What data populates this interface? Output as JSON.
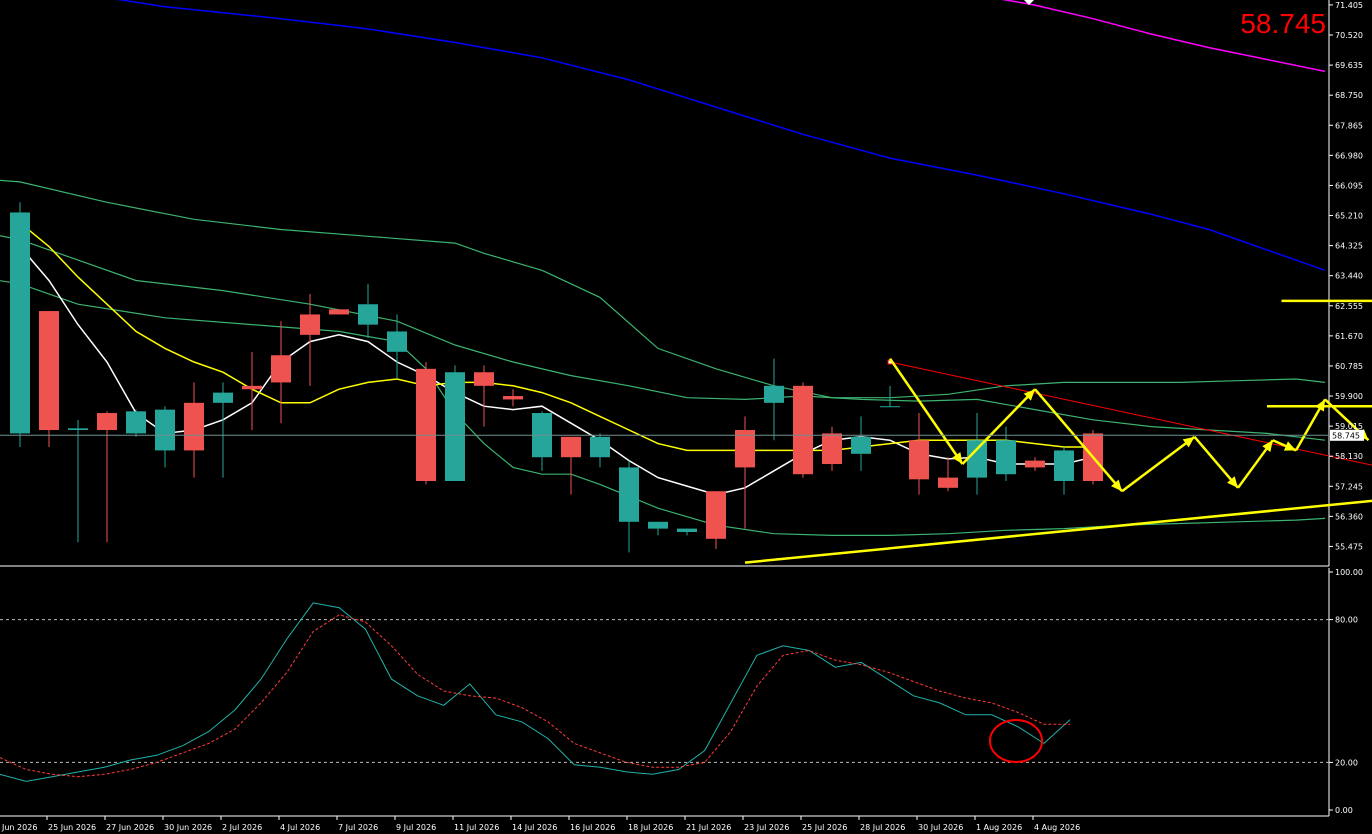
{
  "chart_data": {
    "type": "candlestick",
    "symbol_price": "58.745",
    "current_price_tag": "58.745",
    "price_axis": {
      "ylim": [
        54.9,
        71.55
      ],
      "ticks": [
        "71.405",
        "70.520",
        "69.635",
        "68.750",
        "67.865",
        "66.980",
        "66.095",
        "65.210",
        "64.325",
        "63.440",
        "62.555",
        "61.670",
        "60.785",
        "59.900",
        "59.015",
        "58.130",
        "57.245",
        "56.360",
        "55.475"
      ]
    },
    "date_axis": {
      "ticks": [
        "Jun 2026",
        "25 Jun 2026",
        "27 Jun 2026",
        "30 Jun 2026",
        "2 Jul 2026",
        "4 Jul 2026",
        "7 Jul 2026",
        "9 Jul 2026",
        "11 Jul 2026",
        "14 Jul 2026",
        "16 Jul 2026",
        "18 Jul 2026",
        "21 Jul 2026",
        "23 Jul 2026",
        "25 Jul 2026",
        "28 Jul 2026",
        "30 Jul 2026",
        "1 Aug 2026",
        "4 Aug 2026"
      ]
    },
    "candles": [
      {
        "o": 58.8,
        "h": 65.6,
        "l": 58.4,
        "c": 65.3
      },
      {
        "o": 62.4,
        "h": 62.4,
        "l": 58.4,
        "c": 58.9
      },
      {
        "o": 58.9,
        "h": 59.2,
        "l": 55.6,
        "c": 58.95
      },
      {
        "o": 59.4,
        "h": 59.45,
        "l": 55.6,
        "c": 58.9
      },
      {
        "o": 58.8,
        "h": 59.5,
        "l": 58.7,
        "c": 59.45
      },
      {
        "o": 58.3,
        "h": 59.6,
        "l": 57.8,
        "c": 59.5
      },
      {
        "o": 59.7,
        "h": 60.3,
        "l": 57.5,
        "c": 58.3
      },
      {
        "o": 59.7,
        "h": 60.3,
        "l": 57.5,
        "c": 60.0
      },
      {
        "o": 60.2,
        "h": 61.2,
        "l": 58.9,
        "c": 60.1
      },
      {
        "o": 61.1,
        "h": 62.1,
        "l": 59.1,
        "c": 60.3
      },
      {
        "o": 62.3,
        "h": 62.9,
        "l": 60.2,
        "c": 61.7
      },
      {
        "o": 62.45,
        "h": 62.45,
        "l": 62.3,
        "c": 62.3
      },
      {
        "o": 62.0,
        "h": 63.2,
        "l": 61.6,
        "c": 62.6
      },
      {
        "o": 61.2,
        "h": 62.3,
        "l": 60.4,
        "c": 61.8
      },
      {
        "o": 60.7,
        "h": 60.9,
        "l": 57.3,
        "c": 57.4
      },
      {
        "o": 57.4,
        "h": 60.8,
        "l": 57.4,
        "c": 60.6
      },
      {
        "o": 60.6,
        "h": 60.8,
        "l": 59.0,
        "c": 60.2
      },
      {
        "o": 59.9,
        "h": 60.1,
        "l": 59.6,
        "c": 59.8
      },
      {
        "o": 58.1,
        "h": 59.45,
        "l": 57.7,
        "c": 59.4
      },
      {
        "o": 58.7,
        "h": 58.7,
        "l": 57.0,
        "c": 58.1
      },
      {
        "o": 58.1,
        "h": 58.8,
        "l": 57.8,
        "c": 58.7
      },
      {
        "o": 56.2,
        "h": 58.0,
        "l": 55.3,
        "c": 57.8
      },
      {
        "o": 56.0,
        "h": 56.2,
        "l": 55.8,
        "c": 56.2
      },
      {
        "o": 55.9,
        "h": 56.0,
        "l": 55.8,
        "c": 56.0
      },
      {
        "o": 57.1,
        "h": 57.1,
        "l": 55.4,
        "c": 55.7
      },
      {
        "o": 58.9,
        "h": 59.3,
        "l": 56.0,
        "c": 57.8
      },
      {
        "o": 59.7,
        "h": 61.0,
        "l": 58.6,
        "c": 60.2
      },
      {
        "o": 60.2,
        "h": 60.3,
        "l": 57.5,
        "c": 57.6
      },
      {
        "o": 58.8,
        "h": 59.0,
        "l": 57.7,
        "c": 57.9
      },
      {
        "o": 58.2,
        "h": 59.3,
        "l": 57.7,
        "c": 58.7
      },
      {
        "o": 59.6,
        "h": 60.2,
        "l": 59.6,
        "c": 59.6
      },
      {
        "o": 58.6,
        "h": 59.4,
        "l": 57.0,
        "c": 57.45
      },
      {
        "o": 57.5,
        "h": 58.1,
        "l": 57.1,
        "c": 57.2
      },
      {
        "o": 57.5,
        "h": 59.4,
        "l": 57.0,
        "c": 58.6
      },
      {
        "o": 57.6,
        "h": 59.0,
        "l": 57.4,
        "c": 58.6
      },
      {
        "o": 58.0,
        "h": 58.1,
        "l": 57.7,
        "c": 57.8
      },
      {
        "o": 57.4,
        "h": 58.4,
        "l": 57.0,
        "c": 58.3
      },
      {
        "o": 58.8,
        "h": 58.9,
        "l": 57.3,
        "c": 57.4
      }
    ],
    "moving_averages": [
      {
        "name": "ma-fast-white",
        "color": "#ffffff",
        "values": [
          64.3,
          63.3,
          62.0,
          60.9,
          59.4,
          58.8,
          58.9,
          59.2,
          59.7,
          60.9,
          61.5,
          61.7,
          61.5,
          60.9,
          60.5,
          60.0,
          59.6,
          59.5,
          59.6,
          59.1,
          58.6,
          58.0,
          57.5,
          57.25,
          57.0,
          57.2,
          57.7,
          58.2,
          58.6,
          58.7,
          58.6,
          58.2,
          58.05,
          58.1,
          57.9,
          57.9,
          57.9,
          58.1
        ]
      },
      {
        "name": "ma-yellow",
        "color": "#ffff00",
        "values": [
          65.0,
          64.3,
          63.4,
          62.6,
          61.8,
          61.3,
          60.9,
          60.6,
          60.1,
          59.7,
          59.7,
          60.1,
          60.3,
          60.4,
          60.2,
          60.3,
          60.3,
          60.2,
          60.0,
          59.7,
          59.3,
          58.9,
          58.5,
          58.3,
          58.3,
          58.3,
          58.3,
          58.3,
          58.3,
          58.4,
          58.5,
          58.6,
          58.6,
          58.6,
          58.6,
          58.5,
          58.4,
          58.4
        ]
      },
      {
        "name": "ma-blue",
        "color": "#0000ff",
        "points": [
          [
            -3,
            71.9
          ],
          [
            2,
            71.75
          ],
          [
            5,
            71.35
          ],
          [
            9,
            71.0
          ],
          [
            12,
            70.7
          ],
          [
            15,
            70.3
          ],
          [
            18,
            69.85
          ],
          [
            21,
            69.2
          ],
          [
            24,
            68.4
          ],
          [
            27,
            67.6
          ],
          [
            30,
            66.9
          ],
          [
            33,
            66.4
          ],
          [
            36,
            65.85
          ],
          [
            39,
            65.25
          ],
          [
            41,
            64.8
          ],
          [
            43,
            64.2
          ],
          [
            45,
            63.6
          ]
        ]
      },
      {
        "name": "ma-magenta",
        "color": "#ff00ff",
        "points": [
          [
            33,
            71.7
          ],
          [
            35,
            71.4
          ],
          [
            37,
            71.0
          ],
          [
            39,
            70.55
          ],
          [
            41,
            70.15
          ],
          [
            43,
            69.8
          ],
          [
            45,
            69.45
          ]
        ]
      }
    ],
    "bollinger": {
      "color": "#3cb371",
      "upper": [
        [
          -3,
          66.4
        ],
        [
          0,
          66.2
        ],
        [
          3,
          65.6
        ],
        [
          6,
          65.1
        ],
        [
          9,
          64.8
        ],
        [
          12,
          64.6
        ],
        [
          15,
          64.4
        ],
        [
          16,
          64.1
        ],
        [
          18,
          63.6
        ],
        [
          20,
          62.8
        ],
        [
          22,
          61.3
        ],
        [
          24,
          60.7
        ],
        [
          26,
          60.2
        ],
        [
          28,
          59.85
        ],
        [
          30,
          59.85
        ],
        [
          32,
          59.95
        ],
        [
          34,
          60.2
        ],
        [
          36,
          60.3
        ],
        [
          38,
          60.3
        ],
        [
          40,
          60.3
        ],
        [
          42,
          60.35
        ],
        [
          44,
          60.4
        ],
        [
          45,
          60.3
        ]
      ],
      "middle": [
        [
          -3,
          65.0
        ],
        [
          0,
          64.5
        ],
        [
          2,
          63.9
        ],
        [
          4,
          63.3
        ],
        [
          7,
          63.0
        ],
        [
          10,
          62.6
        ],
        [
          13,
          62.1
        ],
        [
          15,
          61.4
        ],
        [
          17,
          60.9
        ],
        [
          19,
          60.5
        ],
        [
          21,
          60.2
        ],
        [
          23,
          59.85
        ],
        [
          25,
          59.8
        ],
        [
          27,
          59.9
        ],
        [
          29,
          59.8
        ],
        [
          31,
          59.75
        ],
        [
          33,
          59.8
        ],
        [
          35,
          59.5
        ],
        [
          37,
          59.2
        ],
        [
          39,
          59.0
        ],
        [
          41,
          58.9
        ],
        [
          43,
          58.8
        ],
        [
          45,
          58.6
        ]
      ],
      "lower": [
        [
          -3,
          63.6
        ],
        [
          0,
          63.2
        ],
        [
          2,
          62.6
        ],
        [
          5,
          62.2
        ],
        [
          8,
          62.0
        ],
        [
          11,
          61.8
        ],
        [
          13,
          61.5
        ],
        [
          14,
          60.7
        ],
        [
          15,
          59.4
        ],
        [
          16,
          58.5
        ],
        [
          17,
          57.8
        ],
        [
          18,
          57.6
        ],
        [
          19,
          57.6
        ],
        [
          20,
          57.3
        ],
        [
          22,
          56.6
        ],
        [
          24,
          56.1
        ],
        [
          26,
          55.85
        ],
        [
          28,
          55.8
        ],
        [
          30,
          55.8
        ],
        [
          32,
          55.85
        ],
        [
          34,
          55.95
        ],
        [
          36,
          56.0
        ],
        [
          38,
          56.1
        ],
        [
          40,
          56.15
        ],
        [
          42,
          56.2
        ],
        [
          44,
          56.25
        ],
        [
          45,
          56.3
        ]
      ]
    },
    "support_line": {
      "color": "#ffff00",
      "from": [
        25,
        55.0
      ],
      "to": [
        50,
        57.1
      ]
    },
    "resistance_line": {
      "color": "#ff0000",
      "from": [
        30,
        60.9
      ],
      "to": [
        50,
        57.25
      ]
    },
    "target_arrows": [
      {
        "color": "#ffff00",
        "from": [
          43.5,
          62.7
        ],
        "to": [
          54,
          62.7
        ]
      },
      {
        "color": "#ffff00",
        "from": [
          43,
          59.6
        ],
        "to": [
          48.5,
          59.6
        ]
      }
    ],
    "zigzag_paths": [
      {
        "color": "#ffff00",
        "points": [
          [
            30,
            61.0
          ],
          [
            32.5,
            57.9
          ],
          [
            35,
            60.1
          ],
          [
            38,
            57.1
          ],
          [
            40.5,
            58.7
          ],
          [
            42,
            57.2
          ],
          [
            43.2,
            58.6
          ],
          [
            44,
            58.3
          ],
          [
            45,
            59.8
          ],
          [
            46.5,
            58.6
          ]
        ]
      }
    ],
    "stochastic": {
      "ylim": [
        0,
        100
      ],
      "ticks": [
        "100.00",
        "80.00",
        "20.00",
        "0.00"
      ],
      "levels": [
        80,
        20
      ],
      "main": {
        "color": "#20b2aa",
        "values": [
          15,
          12,
          14,
          16,
          18,
          21,
          23,
          27,
          33,
          42,
          55,
          72,
          87,
          85,
          76,
          55,
          48,
          44,
          53,
          40,
          37,
          30,
          19,
          18,
          16,
          15,
          17,
          25,
          45,
          65,
          69,
          67,
          60,
          62,
          55,
          48,
          45,
          40,
          40,
          35,
          28,
          38
        ]
      },
      "signal": {
        "color": "#ff3b3b",
        "values": [
          22,
          17,
          15,
          14,
          15,
          17,
          20,
          24,
          28,
          34,
          45,
          58,
          75,
          82,
          79,
          69,
          57,
          50,
          48,
          47,
          43,
          37,
          28,
          24,
          20,
          18,
          18,
          20,
          33,
          52,
          65,
          67,
          63,
          61,
          58,
          54,
          50,
          47,
          45,
          41,
          36,
          36
        ]
      }
    }
  }
}
